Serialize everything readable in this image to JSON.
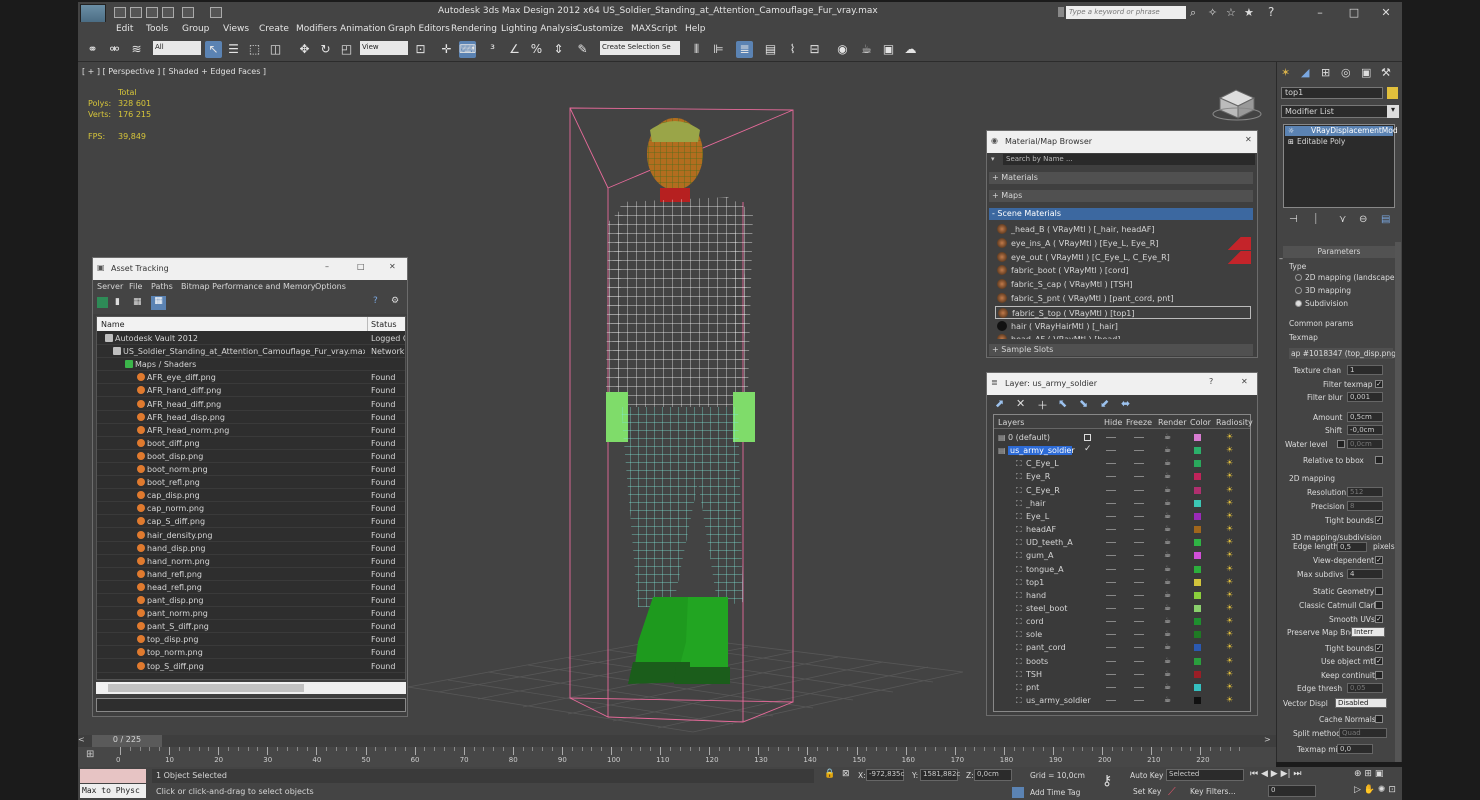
{
  "app": {
    "title": "Autodesk 3ds Max Design 2012 x64      US_Soldier_Standing_at_Attention_Camouflage_Fur_vray.max",
    "logo_text": "3ds",
    "search_placeholder": "Type a keyword or phrase"
  },
  "menu": [
    "Edit",
    "Tools",
    "Group",
    "Views",
    "Create",
    "Modifiers",
    "Animation",
    "Graph Editors",
    "Rendering",
    "Lighting Analysis",
    "Customize",
    "MAXScript",
    "Help"
  ],
  "toolbar": {
    "filter": "All",
    "ref_coord": "View",
    "selection_set": "Create Selection Se"
  },
  "viewport": {
    "label": "[ + ] [ Perspective ] [ Shaded + Edged Faces ]",
    "stats": {
      "header": "Total",
      "polys_label": "Polys:",
      "polys": "328 601",
      "verts_label": "Verts:",
      "verts": "176 215",
      "fps_label": "FPS:",
      "fps": "39,849"
    }
  },
  "asset_tracking": {
    "title": "Asset Tracking",
    "menu": [
      "Server",
      "File",
      "Paths",
      "Bitmap Performance and Memory",
      "Options"
    ],
    "columns": [
      "Name",
      "Status"
    ],
    "rows": [
      {
        "name": "Autodesk Vault 2012",
        "status": "Logged O"
      },
      {
        "name": "US_Soldier_Standing_at_Attention_Camouflage_Fur_vray.max",
        "status": "Network I"
      },
      {
        "name": "Maps / Shaders",
        "status": ""
      },
      {
        "name": "AFR_eye_diff.png",
        "status": "Found"
      },
      {
        "name": "AFR_hand_diff.png",
        "status": "Found"
      },
      {
        "name": "AFR_head_diff.png",
        "status": "Found"
      },
      {
        "name": "AFR_head_disp.png",
        "status": "Found"
      },
      {
        "name": "AFR_head_norm.png",
        "status": "Found"
      },
      {
        "name": "boot_diff.png",
        "status": "Found"
      },
      {
        "name": "boot_disp.png",
        "status": "Found"
      },
      {
        "name": "boot_norm.png",
        "status": "Found"
      },
      {
        "name": "boot_refl.png",
        "status": "Found"
      },
      {
        "name": "cap_disp.png",
        "status": "Found"
      },
      {
        "name": "cap_norm.png",
        "status": "Found"
      },
      {
        "name": "cap_S_diff.png",
        "status": "Found"
      },
      {
        "name": "hair_density.png",
        "status": "Found"
      },
      {
        "name": "hand_disp.png",
        "status": "Found"
      },
      {
        "name": "hand_norm.png",
        "status": "Found"
      },
      {
        "name": "hand_refl.png",
        "status": "Found"
      },
      {
        "name": "head_refl.png",
        "status": "Found"
      },
      {
        "name": "pant_disp.png",
        "status": "Found"
      },
      {
        "name": "pant_norm.png",
        "status": "Found"
      },
      {
        "name": "pant_S_diff.png",
        "status": "Found"
      },
      {
        "name": "top_disp.png",
        "status": "Found"
      },
      {
        "name": "top_norm.png",
        "status": "Found"
      },
      {
        "name": "top_S_diff.png",
        "status": "Found"
      }
    ]
  },
  "material_browser": {
    "title": "Material/Map Browser",
    "search_placeholder": "Search by Name ...",
    "sections": [
      "+ Materials",
      "+ Maps",
      "- Scene Materials",
      "+ Sample Slots"
    ],
    "materials": [
      "_head_B  ( VRayMtl )  [_hair, headAF]",
      "eye_ins_A  ( VRayMtl )  [Eye_L, Eye_R]",
      "eye_out  ( VRayMtl )  [C_Eye_L, C_Eye_R]",
      "fabric_boot  ( VRayMtl )  [cord]",
      "fabric_S_cap  ( VRayMtl )  [TSH]",
      "fabric_S_pnt  ( VRayMtl )  [pant_cord, pnt]",
      "fabric_S_top  ( VRayMtl )  [top1]",
      "hair  ( VRayHairMtl )  [_hair]",
      "head_AF  ( VRayMtl )  [head]"
    ]
  },
  "layers": {
    "title": "Layer: us_army_soldier",
    "columns": [
      "Layers",
      "Hide",
      "Freeze",
      "Render",
      "Color",
      "Radiosity"
    ],
    "rows": [
      {
        "name": "0 (default)",
        "color": "#d77bd0",
        "indent": 0
      },
      {
        "name": "us_army_soldier",
        "color": "#2bb06a",
        "indent": 0
      },
      {
        "name": "C_Eye_L",
        "color": "#2aa85c",
        "indent": 1
      },
      {
        "name": "Eye_R",
        "color": "#c0245a",
        "indent": 1
      },
      {
        "name": "C_Eye_R",
        "color": "#b02f6f",
        "indent": 1
      },
      {
        "name": "_hair",
        "color": "#3cc7b5",
        "indent": 1
      },
      {
        "name": "Eye_L",
        "color": "#9a2ab8",
        "indent": 1
      },
      {
        "name": "headAF",
        "color": "#a0661c",
        "indent": 1
      },
      {
        "name": "UD_teeth_A",
        "color": "#2fb344",
        "indent": 1
      },
      {
        "name": "gum_A",
        "color": "#d14fd8",
        "indent": 1
      },
      {
        "name": "tongue_A",
        "color": "#2cae3c",
        "indent": 1
      },
      {
        "name": "top1",
        "color": "#d2c43c",
        "indent": 1
      },
      {
        "name": "hand",
        "color": "#8bcf3c",
        "indent": 1
      },
      {
        "name": "steel_boot",
        "color": "#8ad06c",
        "indent": 1
      },
      {
        "name": "cord",
        "color": "#1e8f2e",
        "indent": 1
      },
      {
        "name": "sole",
        "color": "#1f7a24",
        "indent": 1
      },
      {
        "name": "pant_cord",
        "color": "#2b59b0",
        "indent": 1
      },
      {
        "name": "boots",
        "color": "#2a9f3d",
        "indent": 1
      },
      {
        "name": "TSH",
        "color": "#9a1e26",
        "indent": 1
      },
      {
        "name": "pnt",
        "color": "#35c0c0",
        "indent": 1
      },
      {
        "name": "us_army_soldier",
        "color": "#111111",
        "indent": 1
      }
    ]
  },
  "command_panel": {
    "object_name": "top1",
    "modifier_list": "Modifier List",
    "stack": [
      "VRayDisplacementMod",
      "Editable Poly"
    ],
    "rollout": "Parameters",
    "type_label": "Type",
    "type_options": [
      "2D mapping (landscape)",
      "3D mapping",
      "Subdivision"
    ],
    "common_label": "Common params",
    "texmap_label": "Texmap",
    "texmap_value": "ap #1018347 (top_disp.png)",
    "texture_chan_label": "Texture chan",
    "texture_chan": "1",
    "filter_texmap": "Filter texmap",
    "filter_blur_label": "Filter blur",
    "filter_blur": "0,001",
    "amount_label": "Amount",
    "amount": "0,5cm",
    "shift_label": "Shift",
    "shift": "-0,0cm",
    "water_label": "Water level",
    "water": "0,0cm",
    "relative_bbox": "Relative to bbox",
    "map2d_label": "2D mapping",
    "resolution_label": "Resolution",
    "resolution": "512",
    "precision_label": "Precision",
    "precision": "8",
    "tight_bounds": "Tight bounds",
    "map3d_label": "3D mapping/subdivision",
    "edge_len_label": "Edge length",
    "edge_len": "0,5",
    "edge_unit": "pixels",
    "view_dep": "View-dependent",
    "max_subdivs_label": "Max subdivs",
    "max_subdivs": "4",
    "static_geo": "Static Geometry",
    "catmull": "Classic Catmull Clark",
    "smooth_uvs": "Smooth UVs",
    "preserve_label": "Preserve Map Bnd",
    "preserve": "Interr",
    "tight_bounds2": "Tight bounds",
    "use_obj_mtl": "Use object mtl",
    "keep_cont": "Keep continuity",
    "edge_thresh_label": "Edge thresh",
    "edge_thresh": "0,05",
    "vector_label": "Vector Displ",
    "vector": "Disabled",
    "cache_normals": "Cache Normals",
    "split_label": "Split method",
    "split": "Quad",
    "texmap_min_label": "Texmap min",
    "texmap_min": "0,0"
  },
  "timeline": {
    "frame": "0 / 225",
    "ticks": [
      "0",
      "10",
      "20",
      "30",
      "40",
      "50",
      "60",
      "70",
      "80",
      "90",
      "100",
      "110",
      "120",
      "130",
      "140",
      "150",
      "160",
      "170",
      "180",
      "190",
      "200",
      "210",
      "220"
    ]
  },
  "status": {
    "script_listener": "Max to Physc",
    "selected": "1 Object Selected",
    "prompt": "Click or click-and-drag to select objects",
    "x_label": "X:",
    "x": "-972,835c",
    "y_label": "Y:",
    "y": "1581,882c",
    "z_label": "Z:",
    "z": "0,0cm",
    "grid": "Grid = 10,0cm",
    "add_time_tag": "Add Time Tag",
    "auto_key": "Auto Key",
    "set_key": "Set Key",
    "key_mode": "Selected",
    "key_filters": "Key Filters...",
    "frame_field": "0"
  }
}
